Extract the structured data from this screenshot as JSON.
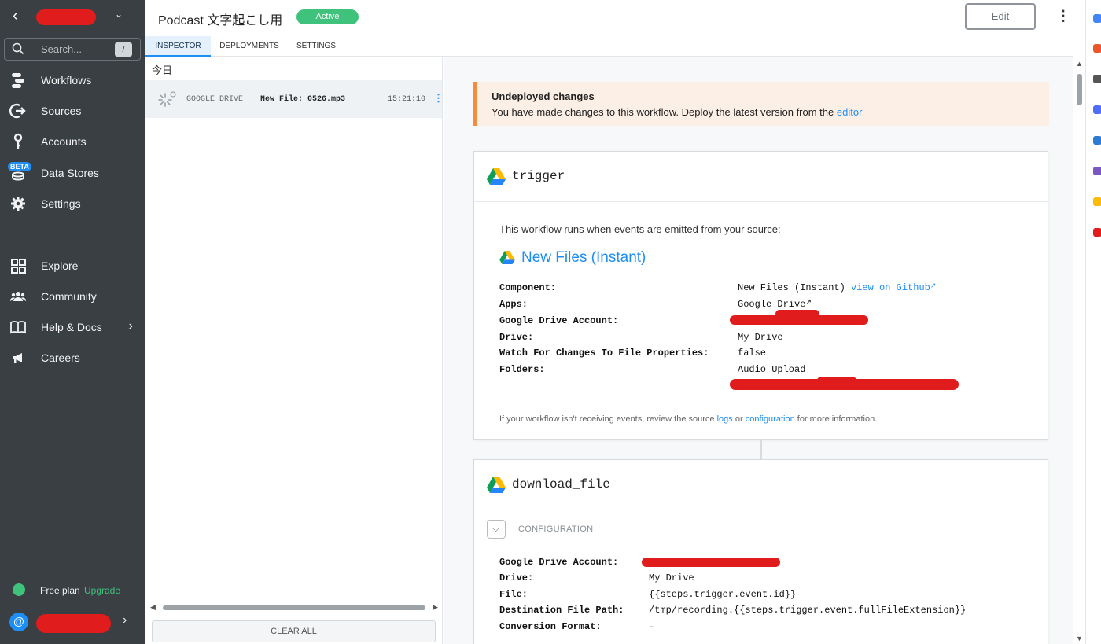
{
  "sidebar": {
    "search_placeholder": "Search...",
    "search_shortcut": "/",
    "nav_primary": [
      {
        "label": "Workflows",
        "icon": "workflows-icon"
      },
      {
        "label": "Sources",
        "icon": "sources-icon"
      },
      {
        "label": "Accounts",
        "icon": "key-icon"
      },
      {
        "label": "Data Stores",
        "icon": "database-icon",
        "badge": "BETA"
      },
      {
        "label": "Settings",
        "icon": "gear-icon"
      }
    ],
    "nav_secondary": [
      {
        "label": "Explore",
        "icon": "grid-icon"
      },
      {
        "label": "Community",
        "icon": "people-icon"
      },
      {
        "label": "Help & Docs",
        "icon": "book-icon"
      },
      {
        "label": "Careers",
        "icon": "megaphone-icon"
      }
    ],
    "plan_label": "Free plan",
    "upgrade_label": "Upgrade",
    "avatar_glyph": "@"
  },
  "header": {
    "title": "Podcast 文字起こし用",
    "status": "Active",
    "edit_label": "Edit",
    "tabs": [
      "INSPECTOR",
      "DEPLOYMENTS",
      "SETTINGS"
    ]
  },
  "events": {
    "date_header": "今日",
    "rows": [
      {
        "source": "GOOGLE DRIVE",
        "summary": "New File: 0526.mp3",
        "time": "15:21:10"
      }
    ],
    "clear_all": "CLEAR ALL"
  },
  "notice": {
    "title": "Undeployed changes",
    "body": "You have made changes to this workflow. Deploy the latest version from the",
    "link": "editor"
  },
  "trigger": {
    "name": "trigger",
    "intro": "This workflow runs when events are emitted from your source:",
    "source_title": "New Files (Instant)",
    "props": [
      {
        "key": "Component:",
        "value": "New Files (Instant)",
        "link": "view on Github"
      },
      {
        "key": "Apps:",
        "value": "",
        "link": "Google Drive"
      },
      {
        "key": "Google Drive Account:",
        "value": ""
      },
      {
        "key": "Drive:",
        "value": "My Drive"
      },
      {
        "key": "Watch For Changes To File Properties:",
        "value": "false"
      },
      {
        "key": "Folders:",
        "value": "Audio Upload"
      }
    ],
    "footer_pre": "If your workflow isn't receiving events, review the source",
    "footer_logs": "logs",
    "footer_or": "or",
    "footer_config": "configuration",
    "footer_post": "for more information."
  },
  "download_file": {
    "name": "download_file",
    "config_label": "CONFIGURATION",
    "props": [
      {
        "key": "Google Drive Account:",
        "value": ""
      },
      {
        "key": "Drive:",
        "value": "My Drive"
      },
      {
        "key": "File:",
        "value": "{{steps.trigger.event.id}}"
      },
      {
        "key": "Destination File Path:",
        "value": "/tmp/recording.{{steps.trigger.event.fullFileExtension}}"
      },
      {
        "key": "Conversion Format:",
        "value": "-"
      }
    ]
  },
  "colors": {
    "sidebar_bg": "#3a3f44",
    "accent": "#1d8ef5",
    "active_green": "#3fc27b",
    "notice_border": "#f48b3d",
    "redaction": "#e01c1c"
  }
}
